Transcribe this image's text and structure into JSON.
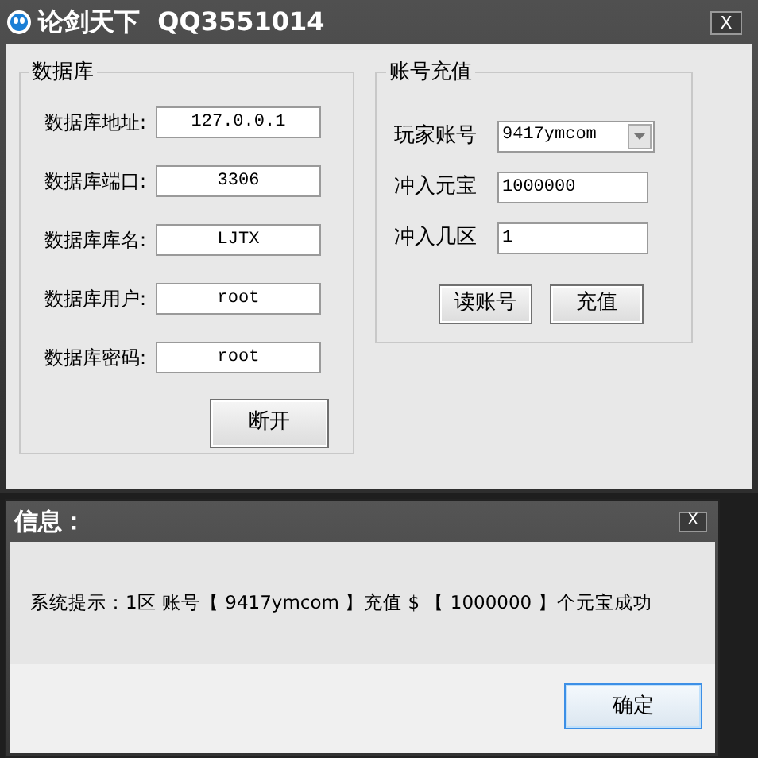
{
  "window": {
    "title": "论剑天下  QQ3551014",
    "close": "X"
  },
  "database": {
    "title": "数据库",
    "fields": [
      {
        "label": "数据库地址:",
        "value": "127.0.0.1"
      },
      {
        "label": "数据库端口:",
        "value": "3306"
      },
      {
        "label": "数据库库名:",
        "value": "LJTX"
      },
      {
        "label": "数据库用户:",
        "value": "root"
      },
      {
        "label": "数据库密码:",
        "value": "root"
      }
    ],
    "button": "断开"
  },
  "recharge": {
    "title": "账号充值",
    "fields": [
      {
        "kind": "combo",
        "label": "玩家账号",
        "value": "9417ymcom"
      },
      {
        "kind": "text",
        "label": "冲入元宝",
        "value": "1000000"
      },
      {
        "kind": "text",
        "label": "冲入几区",
        "value": "1"
      }
    ],
    "buttons": [
      "读账号",
      "充值"
    ]
  },
  "dialog": {
    "title": "信息：",
    "close": "X",
    "message": "系统提示：1区  账号【 9417ymcom 】充值 $ 【 1000000 】个元宝成功",
    "button": "确定"
  }
}
